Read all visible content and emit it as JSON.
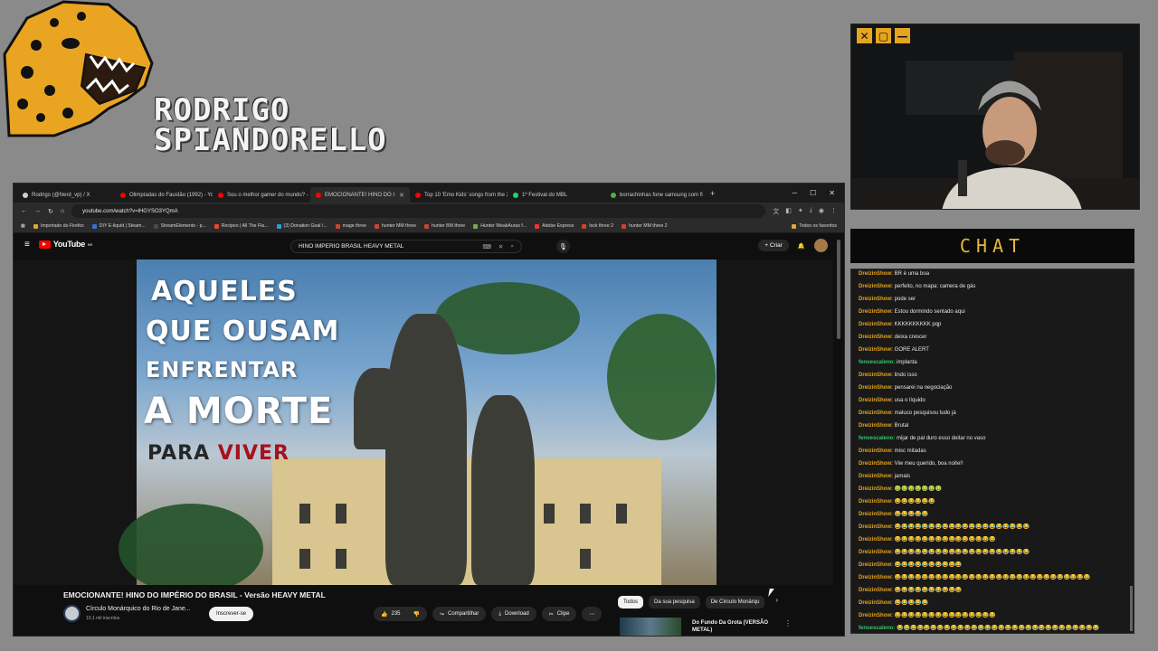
{
  "overlay": {
    "streamer_name_line1": "RODRIGO",
    "streamer_name_line2": "SPIANDORELLO",
    "chat_header": "CHAT",
    "webcam_buttons": [
      "✕",
      "▢",
      "—"
    ]
  },
  "colors": {
    "accent": "#e5a51f",
    "chat_user_a": "#e5a51f",
    "chat_user_b": "#35c46a",
    "youtube_red": "#ff0000",
    "video_red_text": "#a8101a"
  },
  "browser": {
    "tabs": [
      {
        "label": "Rodrigo (@Nerd_vp) / X",
        "icon": "x-icon",
        "color": "#cfcfcf"
      },
      {
        "label": "Olimpíadas do Faustão (1992) - You",
        "icon": "youtube-icon",
        "color": "#ff0000"
      },
      {
        "label": "Sou o melhor gamer do mundo? -",
        "icon": "youtube-icon",
        "color": "#ff0000"
      },
      {
        "label": "EMOCIONANTE! HINO DO I",
        "icon": "youtube-icon",
        "color": "#ff0000",
        "active": true
      },
      {
        "label": "Top 10 'Emo Kids' songs from the 2",
        "icon": "youtube-icon",
        "color": "#ff0000"
      },
      {
        "label": "1º Festival do MBL",
        "icon": "whatsapp-icon",
        "color": "#25d366"
      },
      {
        "label": "borrachinhas fone samsung com fi",
        "icon": "shopping-icon",
        "color": "#4caf50"
      }
    ],
    "url": "youtube.com/watch?v=lHGYSO3YQmA",
    "bookmarks": [
      "Importado do Firefox",
      "DIY E-liquid | Steam...",
      "StreamElements - p...",
      "Recipes | All The Fla...",
      "(3) Donation Goal /...",
      "mage three",
      "hunter MM three",
      "hunter BM three",
      "Hunter WeakAuras f...",
      "Adobe Express",
      "lock three 2",
      "hunter MM three 2"
    ],
    "bookmarks_all": "Todos os favoritos"
  },
  "youtube": {
    "logo_text": "YouTube",
    "logo_region": "BR",
    "search_query": "HINO IMPERIO BRASIL HEAVY METAL",
    "create_label": "Criar",
    "video_overlay": {
      "line1": "AQUELES",
      "line2": "QUE OUSAM",
      "line3": "ENFRENTAR",
      "line4": "A MORTE",
      "line5a": "PARA ",
      "line5b": "VIVER"
    },
    "title": "EMOCIONANTE! HINO DO IMPÉRIO DO BRASIL - Versão HEAVY METAL",
    "channel": "Círculo Monárquico do Rio de Jane...",
    "subscribers": "10,1 mil inscritos",
    "subscribe_label": "Inscrever-se",
    "likes": "235",
    "share_label": "Compartilhar",
    "download_label": "Download",
    "clip_label": "Clipe",
    "chips": [
      "Todos",
      "Da sua pesquisa",
      "De Círculo Monárqu"
    ],
    "rec_title": "Do Fundo Da Grota (VERSÃO METAL)"
  },
  "chat": {
    "messages": [
      {
        "user": "DreizinShow:",
        "text": " BR é uma boa",
        "user_color": "#e5a51f"
      },
      {
        "user": "DreizinShow:",
        "text": " perfeito, no mapa: camera de gás",
        "user_color": "#e5a51f"
      },
      {
        "user": "DreizinShow:",
        "text": " pode ser",
        "user_color": "#e5a51f"
      },
      {
        "user": "DreizinShow:",
        "text": " Estou dormindo sentado aqui",
        "user_color": "#e5a51f"
      },
      {
        "user": "DreizinShow:",
        "text": " KKKKKKKKKK pqp",
        "user_color": "#e5a51f"
      },
      {
        "user": "DreizinShow:",
        "text": " deixa crescer",
        "user_color": "#e5a51f"
      },
      {
        "user": "DreizinShow:",
        "text": " GORE ALERT",
        "user_color": "#e5a51f"
      },
      {
        "user": "fenoescaleno:",
        "text": " implanta",
        "user_color": "#35c46a"
      },
      {
        "user": "DreizinShow:",
        "text": " lindo isso",
        "user_color": "#e5a51f"
      },
      {
        "user": "DreizinShow:",
        "text": " pensarei na negociação",
        "user_color": "#e5a51f"
      },
      {
        "user": "DreizinShow:",
        "text": " usa o líquido",
        "user_color": "#e5a51f"
      },
      {
        "user": "DreizinShow:",
        "text": " maluco pesquisou tudo já",
        "user_color": "#e5a51f"
      },
      {
        "user": "DreizinShow:",
        "text": " Brutal",
        "user_color": "#e5a51f"
      },
      {
        "user": "fenoescaleno:",
        "text": " mijar de pal duro esso deitar no vaso",
        "user_color": "#35c46a"
      },
      {
        "user": "DreizinShow:",
        "text": " misc mitadas",
        "user_color": "#e5a51f"
      },
      {
        "user": "DreizinShow:",
        "text": " Viw meu querido, boa noite!!",
        "user_color": "#e5a51f"
      },
      {
        "user": "DreizinShow:",
        "text": " jamais",
        "user_color": "#e5a51f"
      },
      {
        "user": "DreizinShow:",
        "text": " 🤢🤢🤢🤢🤢🤢🤢",
        "user_color": "#e5a51f"
      },
      {
        "user": "DreizinShow:",
        "text": " 😂😂😂😂😂😂",
        "user_color": "#e5a51f"
      },
      {
        "user": "DreizinShow:",
        "text": " 😂😂😂😂😂",
        "user_color": "#e5a51f"
      },
      {
        "user": "DreizinShow:",
        "text": " 😂😂😂😂😂😂😂😂😂😂😂😂😂😂😂😂😂😂😂😂",
        "user_color": "#e5a51f"
      },
      {
        "user": "DreizinShow:",
        "text": " 😂😂😂😂😂😂😂😂😂😂😂😂😂😂😂",
        "user_color": "#e5a51f"
      },
      {
        "user": "DreizinShow:",
        "text": " 😂😂😂😂😂😂😂😂😂😂😂😂😂😂😂😂😂😂😂😂",
        "user_color": "#e5a51f"
      },
      {
        "user": "DreizinShow:",
        "text": " 😂😂😂😂😂😂😂😂😂😂",
        "user_color": "#e5a51f"
      },
      {
        "user": "DreizinShow:",
        "text": " 😂😂😂😂😂😂😂😂😂😂😂😂😂😂😂😂😂😂😂😂😂😂😂😂😂😂😂😂😂",
        "user_color": "#e5a51f"
      },
      {
        "user": "DreizinShow:",
        "text": " 😂😂😂😂😂😂😂😂😂😂",
        "user_color": "#e5a51f"
      },
      {
        "user": "DreizinShow:",
        "text": " 😂😂😂😂😂",
        "user_color": "#e5a51f"
      },
      {
        "user": "DreizinShow:",
        "text": " 😂😂😂😂😂😂😂😂😂😂😂😂😂😂😂",
        "user_color": "#e5a51f"
      },
      {
        "user": "fenoescaleno:",
        "text": " 😂😂😂😂😂😂😂😂😂😂😂😂😂😂😂😂😂😂😂😂😂😂😂😂😂😂😂😂😂😂",
        "user_color": "#35c46a"
      }
    ]
  }
}
